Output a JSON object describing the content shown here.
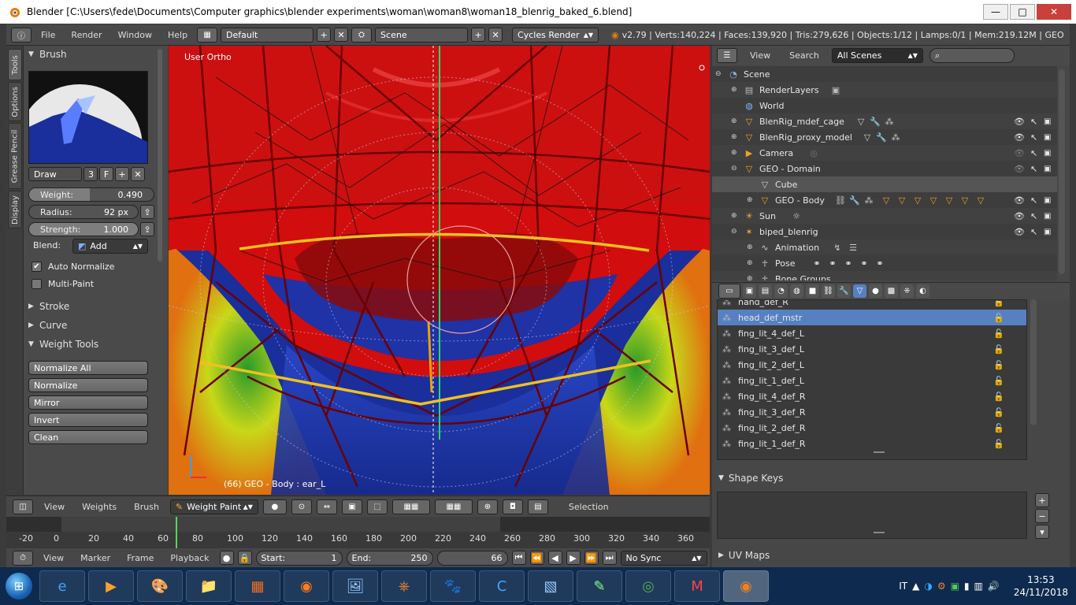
{
  "window": {
    "title": "Blender  [C:\\Users\\fede\\Documents\\Computer graphics\\blender experiments\\woman\\woman8\\woman18_blenrig_baked_6.blend]",
    "min": "—",
    "max": "□",
    "close": "✕"
  },
  "topbar": {
    "menus": [
      "File",
      "Render",
      "Window",
      "Help"
    ],
    "layout": "Default",
    "scene": "Scene",
    "engine": "Cycles Render",
    "stats": "v2.79 | Verts:140,224 | Faces:139,920 | Tris:279,626 | Objects:1/12 | Lamps:0/1 | Mem:219.12M | GEO - Bo"
  },
  "tool_tabs": [
    "Tools",
    "Options",
    "Grease Pencil",
    "Display"
  ],
  "brush_panel": {
    "header": "Brush",
    "brush_name": "Draw",
    "brush_users": "3",
    "fake_user": "F",
    "weight_label": "Weight:",
    "weight_value": "0.490",
    "weight_fraction": 0.49,
    "radius_label": "Radius:",
    "radius_value": "92 px",
    "strength_label": "Strength:",
    "strength_value": "1.000",
    "strength_fraction": 1.0,
    "blend_label": "Blend:",
    "blend_value": "Add",
    "auto_normalize": "Auto Normalize",
    "auto_normalize_checked": true,
    "multi_paint": "Multi-Paint",
    "multi_paint_checked": false
  },
  "collapsed_panels": [
    "Stroke",
    "Curve"
  ],
  "weight_tools": {
    "header": "Weight Tools",
    "buttons": [
      "Normalize All",
      "Normalize",
      "Mirror",
      "Invert",
      "Clean"
    ]
  },
  "viewport": {
    "view_name": "User Ortho",
    "info": "(66) GEO - Body : ear_L"
  },
  "viewport_header": {
    "menus": [
      "View",
      "Weights",
      "Brush"
    ],
    "mode": "Weight Paint",
    "selection": "Selection"
  },
  "timeline": {
    "ticks": [
      "-20",
      "0",
      "20",
      "40",
      "60",
      "80",
      "100",
      "120",
      "140",
      "160",
      "180",
      "200",
      "220",
      "240",
      "260",
      "280",
      "300",
      "320",
      "340",
      "360"
    ]
  },
  "bottombar": {
    "menus": [
      "View",
      "Marker",
      "Frame",
      "Playback"
    ],
    "start_label": "Start:",
    "start_value": "1",
    "end_label": "End:",
    "end_value": "250",
    "current_frame": "66",
    "sync": "No Sync"
  },
  "outliner": {
    "menus": [
      "View",
      "Search"
    ],
    "filter": "All Scenes",
    "items": [
      {
        "name": "Scene",
        "icon": "scene-icon"
      },
      {
        "name": "RenderLayers",
        "icon": "renderlayers-icon"
      },
      {
        "name": "World",
        "icon": "world-icon"
      },
      {
        "name": "BlenRig_mdef_cage",
        "icon": "mesh-object-icon"
      },
      {
        "name": "BlenRig_proxy_model",
        "icon": "mesh-object-icon"
      },
      {
        "name": "Camera",
        "icon": "camera-icon"
      },
      {
        "name": "GEO - Domain",
        "icon": "mesh-object-icon"
      },
      {
        "name": "Cube",
        "icon": "mesh-data-icon"
      },
      {
        "name": "GEO - Body",
        "icon": "mesh-object-icon"
      },
      {
        "name": "Sun",
        "icon": "lamp-icon"
      },
      {
        "name": "biped_blenrig",
        "icon": "armature-icon"
      },
      {
        "name": "Animation",
        "icon": "animation-icon"
      },
      {
        "name": "Pose",
        "icon": "pose-icon"
      },
      {
        "name": "Bone Groups",
        "icon": "bone-groups-icon"
      }
    ]
  },
  "vertex_groups": [
    "hand_def_R",
    "head_def_mstr",
    "fing_lit_4_def_L",
    "fing_lit_3_def_L",
    "fing_lit_2_def_L",
    "fing_lit_1_def_L",
    "fing_lit_4_def_R",
    "fing_lit_3_def_R",
    "fing_lit_2_def_R",
    "fing_lit_1_def_R"
  ],
  "active_vertex_group": "head_def_mstr",
  "panels": {
    "shape_keys": "Shape Keys",
    "uv_maps": "UV Maps"
  },
  "taskbar": {
    "language": "IT",
    "time": "13:53",
    "date": "24/11/2018"
  },
  "colors": {
    "accent_blue": "#5680c2",
    "weight_red": "#d40000",
    "weight_blue": "#1a2e9c",
    "timeline_cursor": "#5ed15e"
  }
}
